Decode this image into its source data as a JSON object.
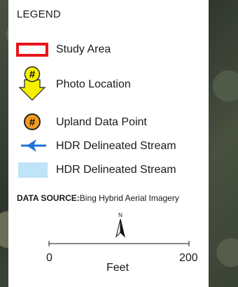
{
  "legend": {
    "title": "LEGEND",
    "items": [
      {
        "label": "Study Area",
        "icon": "study-area-outline-icon",
        "color": "#e8141b"
      },
      {
        "label": "Photo Location",
        "icon": "photo-location-arrow-icon",
        "symbol_text": "#",
        "color": "#f5f000"
      },
      {
        "label": "Upland Data Point",
        "icon": "upland-data-point-icon",
        "symbol_text": "#",
        "color": "#f39c1f"
      },
      {
        "label": "HDR Delineated Stream",
        "icon": "stream-flow-arrow-icon",
        "color": "#1e73d8"
      },
      {
        "label": "HDR Delineated Stream",
        "icon": "stream-polygon-swatch-icon",
        "color": "#bfe3f7"
      }
    ]
  },
  "data_source": {
    "label": "DATA SOURCE:",
    "value": "Bing Hybrid Aerial Imagery"
  },
  "north_arrow": {
    "label": "N"
  },
  "scale_bar": {
    "ticks": [
      "0",
      "200"
    ],
    "units": "Feet"
  }
}
